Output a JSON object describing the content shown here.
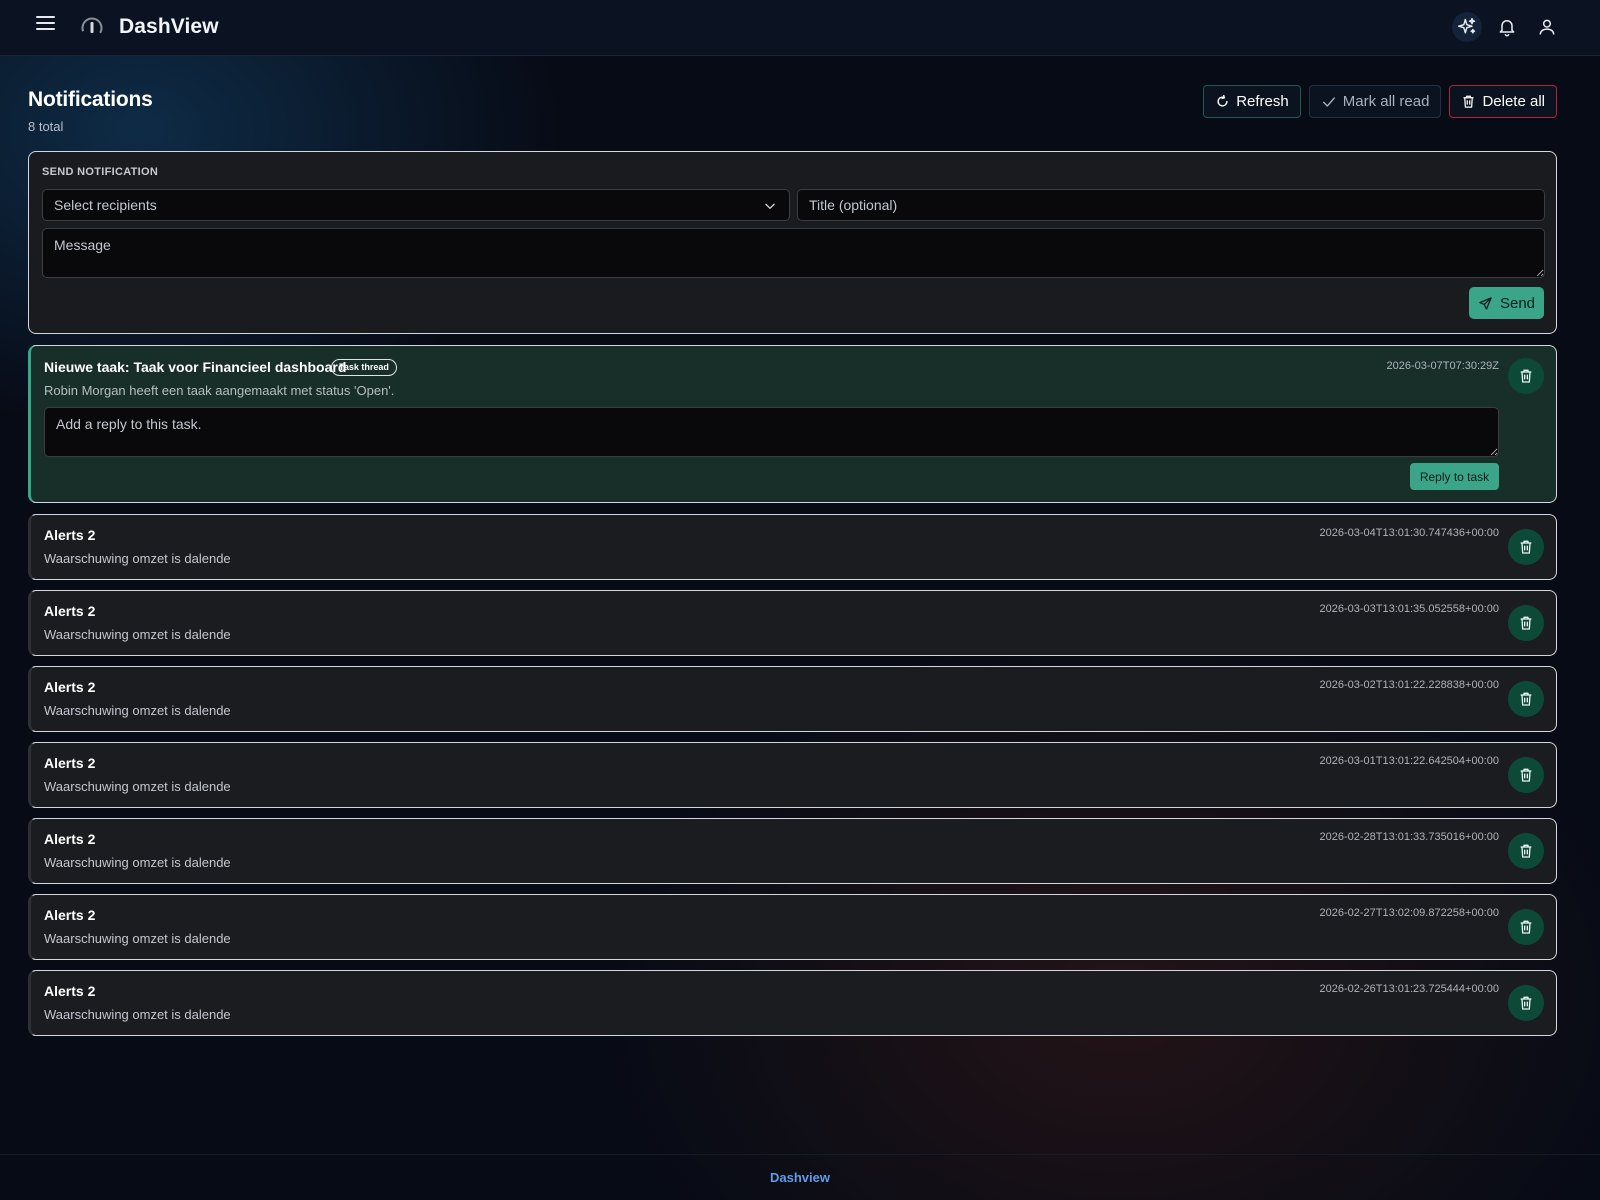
{
  "app": {
    "brand": "DashView"
  },
  "page": {
    "title": "Notifications",
    "subtitle": "8 total"
  },
  "actions": {
    "refresh": "Refresh",
    "mark_all_read": "Mark all read",
    "delete_all": "Delete all"
  },
  "send": {
    "section_label": "SEND NOTIFICATION",
    "recipients_placeholder": "Select recipients",
    "title_placeholder": "Title (optional)",
    "message_placeholder": "Message",
    "send_label": "Send"
  },
  "task": {
    "title": "Nieuwe taak: Taak voor Financieel dashboard",
    "badge": "Task thread",
    "description": "Robin Morgan heeft een taak aangemaakt met status 'Open'.",
    "timestamp": "2026-03-07T07:30:29Z",
    "reply_placeholder": "Add a reply to this task.",
    "reply_button": "Reply to task"
  },
  "alerts": [
    {
      "title": "Alerts 2",
      "message": "Waarschuwing omzet is dalende",
      "timestamp": "2026-03-04T13:01:30.747436+00:00"
    },
    {
      "title": "Alerts 2",
      "message": "Waarschuwing omzet is dalende",
      "timestamp": "2026-03-03T13:01:35.052558+00:00"
    },
    {
      "title": "Alerts 2",
      "message": "Waarschuwing omzet is dalende",
      "timestamp": "2026-03-02T13:01:22.228838+00:00"
    },
    {
      "title": "Alerts 2",
      "message": "Waarschuwing omzet is dalende",
      "timestamp": "2026-03-01T13:01:22.642504+00:00"
    },
    {
      "title": "Alerts 2",
      "message": "Waarschuwing omzet is dalende",
      "timestamp": "2026-02-28T13:01:33.735016+00:00"
    },
    {
      "title": "Alerts 2",
      "message": "Waarschuwing omzet is dalende",
      "timestamp": "2026-02-27T13:02:09.872258+00:00"
    },
    {
      "title": "Alerts 2",
      "message": "Waarschuwing omzet is dalende",
      "timestamp": "2026-02-26T13:01:23.725444+00:00"
    }
  ],
  "footer": {
    "link": "Dashview"
  },
  "icons": {
    "menu": "menu-icon",
    "logo": "logo-icon",
    "sparkle": "sparkle-icon",
    "bell": "bell-icon",
    "user": "user-icon",
    "refresh": "refresh-icon",
    "check": "check-icon",
    "trash": "trash-icon",
    "send": "send-icon",
    "chevron": "chevron-down-icon"
  },
  "colors": {
    "accent": "#3aa588",
    "danger": "#b2213a",
    "link": "#5f9bea",
    "task_background": "#182f29"
  }
}
